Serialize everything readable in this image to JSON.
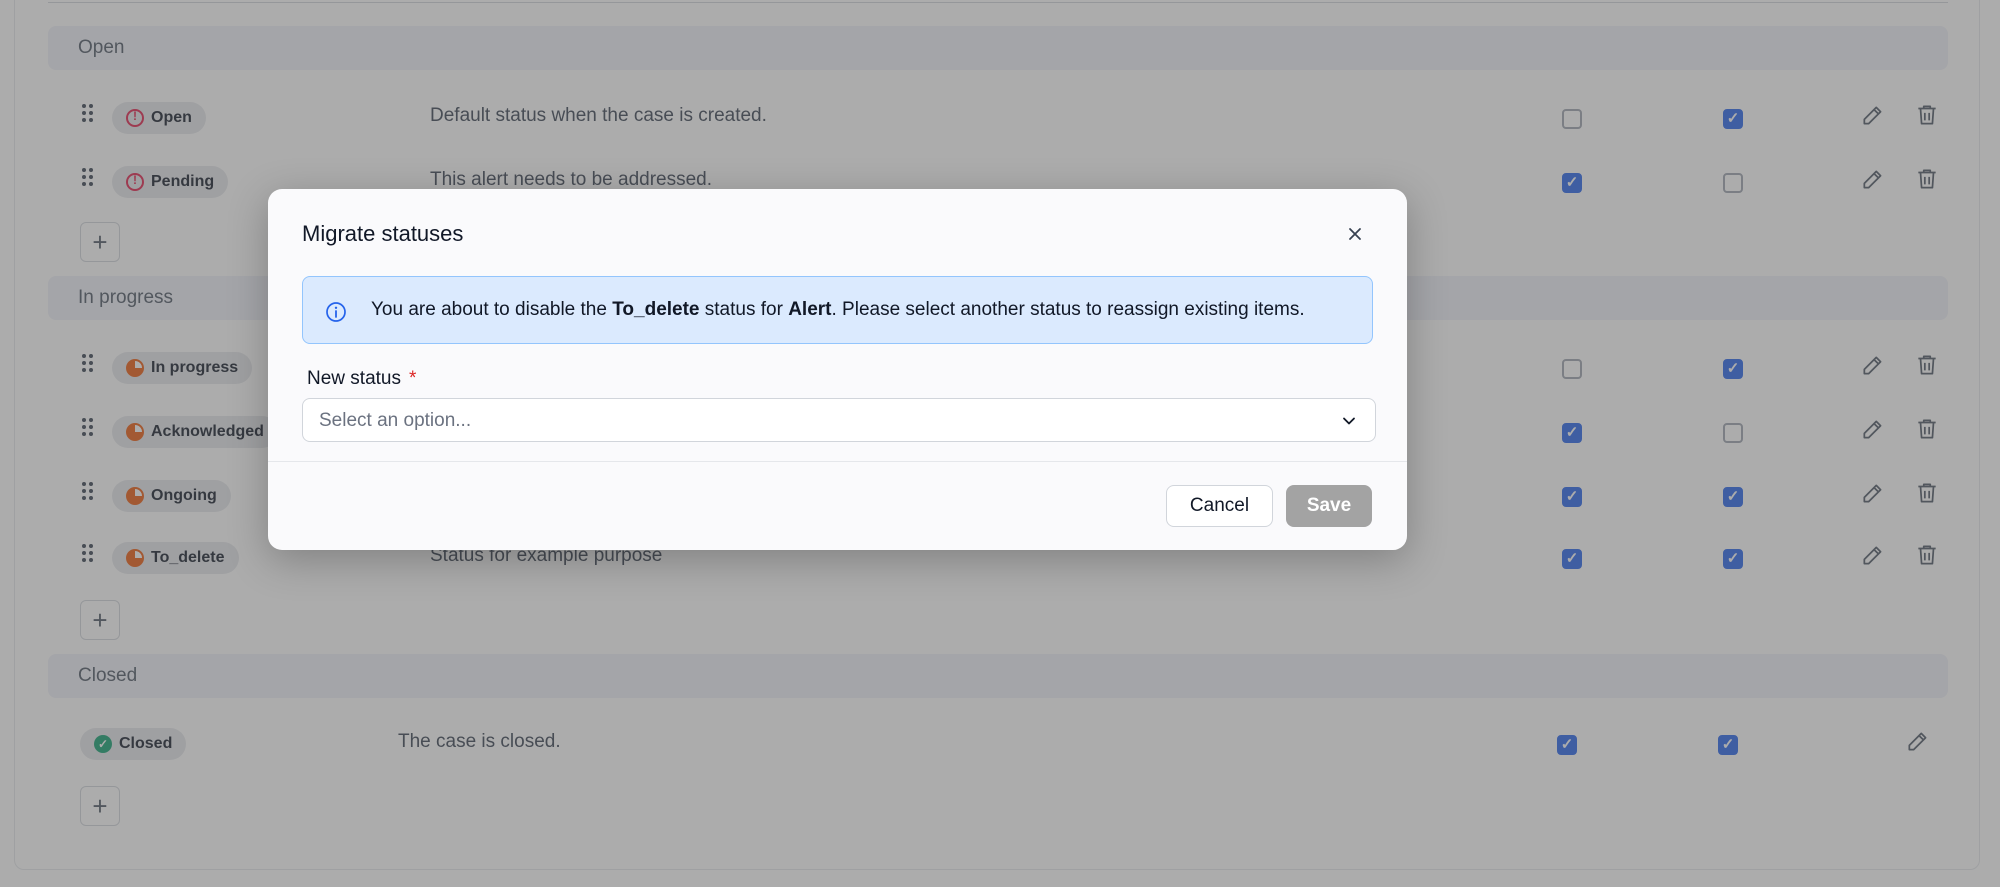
{
  "groups": [
    {
      "title": "Open",
      "rows": [
        {
          "status": "Open",
          "icon": "alert-circle-icon",
          "description": "Default status when the case is created.",
          "check1": false,
          "check2": true
        },
        {
          "status": "Pending",
          "icon": "alert-circle-icon",
          "description": "This alert needs to be addressed.",
          "check1": true,
          "check2": false
        }
      ]
    },
    {
      "title": "In progress",
      "rows": [
        {
          "status": "In progress",
          "icon": "progress-pie-icon",
          "description": "",
          "check1": false,
          "check2": true
        },
        {
          "status": "Acknowledged",
          "icon": "progress-pie-icon",
          "description": "",
          "check1": true,
          "check2": false
        },
        {
          "status": "Ongoing",
          "icon": "progress-pie-icon",
          "description": "",
          "check1": true,
          "check2": true
        },
        {
          "status": "To_delete",
          "icon": "progress-pie-icon",
          "description": "Status for example purpose",
          "check1": true,
          "check2": true
        }
      ]
    },
    {
      "title": "Closed",
      "rows": [
        {
          "status": "Closed",
          "icon": "check-circle-icon",
          "description": "The case is closed.",
          "check1": true,
          "check2": true
        }
      ]
    }
  ],
  "add_label": "+",
  "colors": {
    "accent": "#2563eb",
    "open_icon": "#e11d48",
    "progress_icon": "#ea580c",
    "closed_icon": "#0f9f6e",
    "info_bg": "#dbeafe"
  },
  "modal": {
    "title": "Migrate statuses",
    "close_icon": "close-icon",
    "info": {
      "pre": "You are about to disable the ",
      "status": "To_delete",
      "mid": " status for ",
      "entity": "Alert",
      "post": ". Please select another status to reassign existing items."
    },
    "field_label": "New status",
    "required_mark": "*",
    "select_placeholder": "Select an option...",
    "cancel_label": "Cancel",
    "save_label": "Save"
  }
}
